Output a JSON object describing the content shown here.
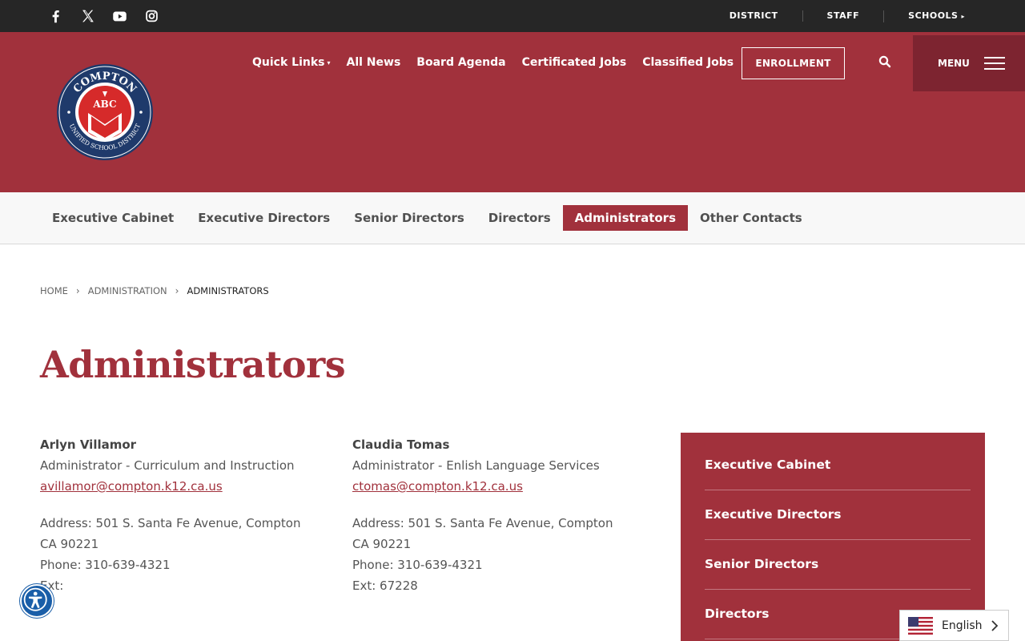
{
  "colors": {
    "brand_red": "#a1313c",
    "dark_red": "#7d2430",
    "topbar": "#262626",
    "accessibility_blue": "#1a5ea8"
  },
  "topbar": {
    "social_icons": [
      "facebook-icon",
      "x-twitter-icon",
      "youtube-icon",
      "instagram-icon"
    ],
    "links": [
      {
        "label": "DISTRICT"
      },
      {
        "label": "STAFF"
      },
      {
        "label": "SCHOOLS"
      }
    ]
  },
  "header": {
    "logo": {
      "top_text": "COMPTON",
      "ring_text": "UNIFIED SCHOOL DISTRICT",
      "letters": "ABC"
    },
    "nav": [
      {
        "label": "Quick Links"
      },
      {
        "label": "All News"
      },
      {
        "label": "Board Agenda"
      },
      {
        "label": "Certificated Jobs"
      },
      {
        "label": "Classified Jobs"
      }
    ],
    "enrollment_label": "ENROLLMENT",
    "menu_label": "MENU"
  },
  "subnav": [
    {
      "label": "Executive Cabinet"
    },
    {
      "label": "Executive Directors"
    },
    {
      "label": "Senior Directors"
    },
    {
      "label": "Directors"
    },
    {
      "label": "Administrators"
    },
    {
      "label": "Other Contacts"
    }
  ],
  "breadcrumb": {
    "home": "HOME",
    "section": "ADMINISTRATION",
    "current": "ADMINISTRATORS"
  },
  "page_title": "Administrators",
  "staff": [
    {
      "name": "Arlyn Villamor",
      "title": "Administrator - Curriculum and Instruction",
      "email": "avillamor@compton.k12.ca.us",
      "address_line1": "Address: 501 S. Santa Fe Avenue, Compton",
      "address_line2": "CA 90221",
      "phone": "Phone: 310-639-4321",
      "ext": "Ext:"
    },
    {
      "name": "Claudia Tomas",
      "title": "Administrator - Enlish Language Services",
      "email": "ctomas@compton.k12.ca.us",
      "address_line1": "Address: 501 S. Santa Fe Avenue, Compton",
      "address_line2": "CA 90221",
      "phone": "Phone: 310-639-4321",
      "ext": "Ext: 67228"
    }
  ],
  "side_menu": [
    {
      "label": "Executive Cabinet"
    },
    {
      "label": "Executive Directors"
    },
    {
      "label": "Senior Directors"
    },
    {
      "label": "Directors"
    }
  ],
  "language": {
    "selected": "English"
  }
}
